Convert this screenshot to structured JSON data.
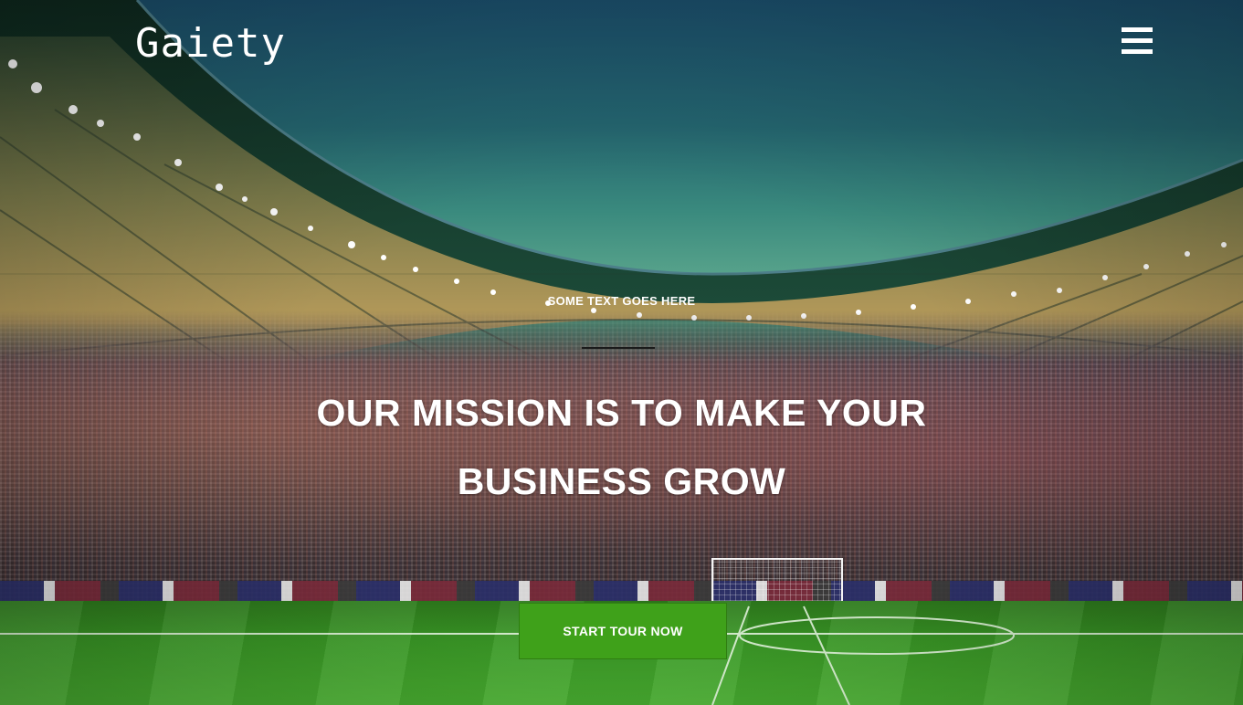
{
  "brand": {
    "logo_text": "Gaiety"
  },
  "nav": {
    "menu_icon": "hamburger-menu-icon"
  },
  "hero": {
    "eyebrow": "SOME TEXT GOES HERE",
    "headline_line1": "OUR MISSION IS TO MAKE YOUR",
    "headline_line2": "BUSINESS GROW",
    "cta_label": "START TOUR NOW"
  },
  "colors": {
    "cta_background": "#3fa11a",
    "text": "#ffffff"
  }
}
